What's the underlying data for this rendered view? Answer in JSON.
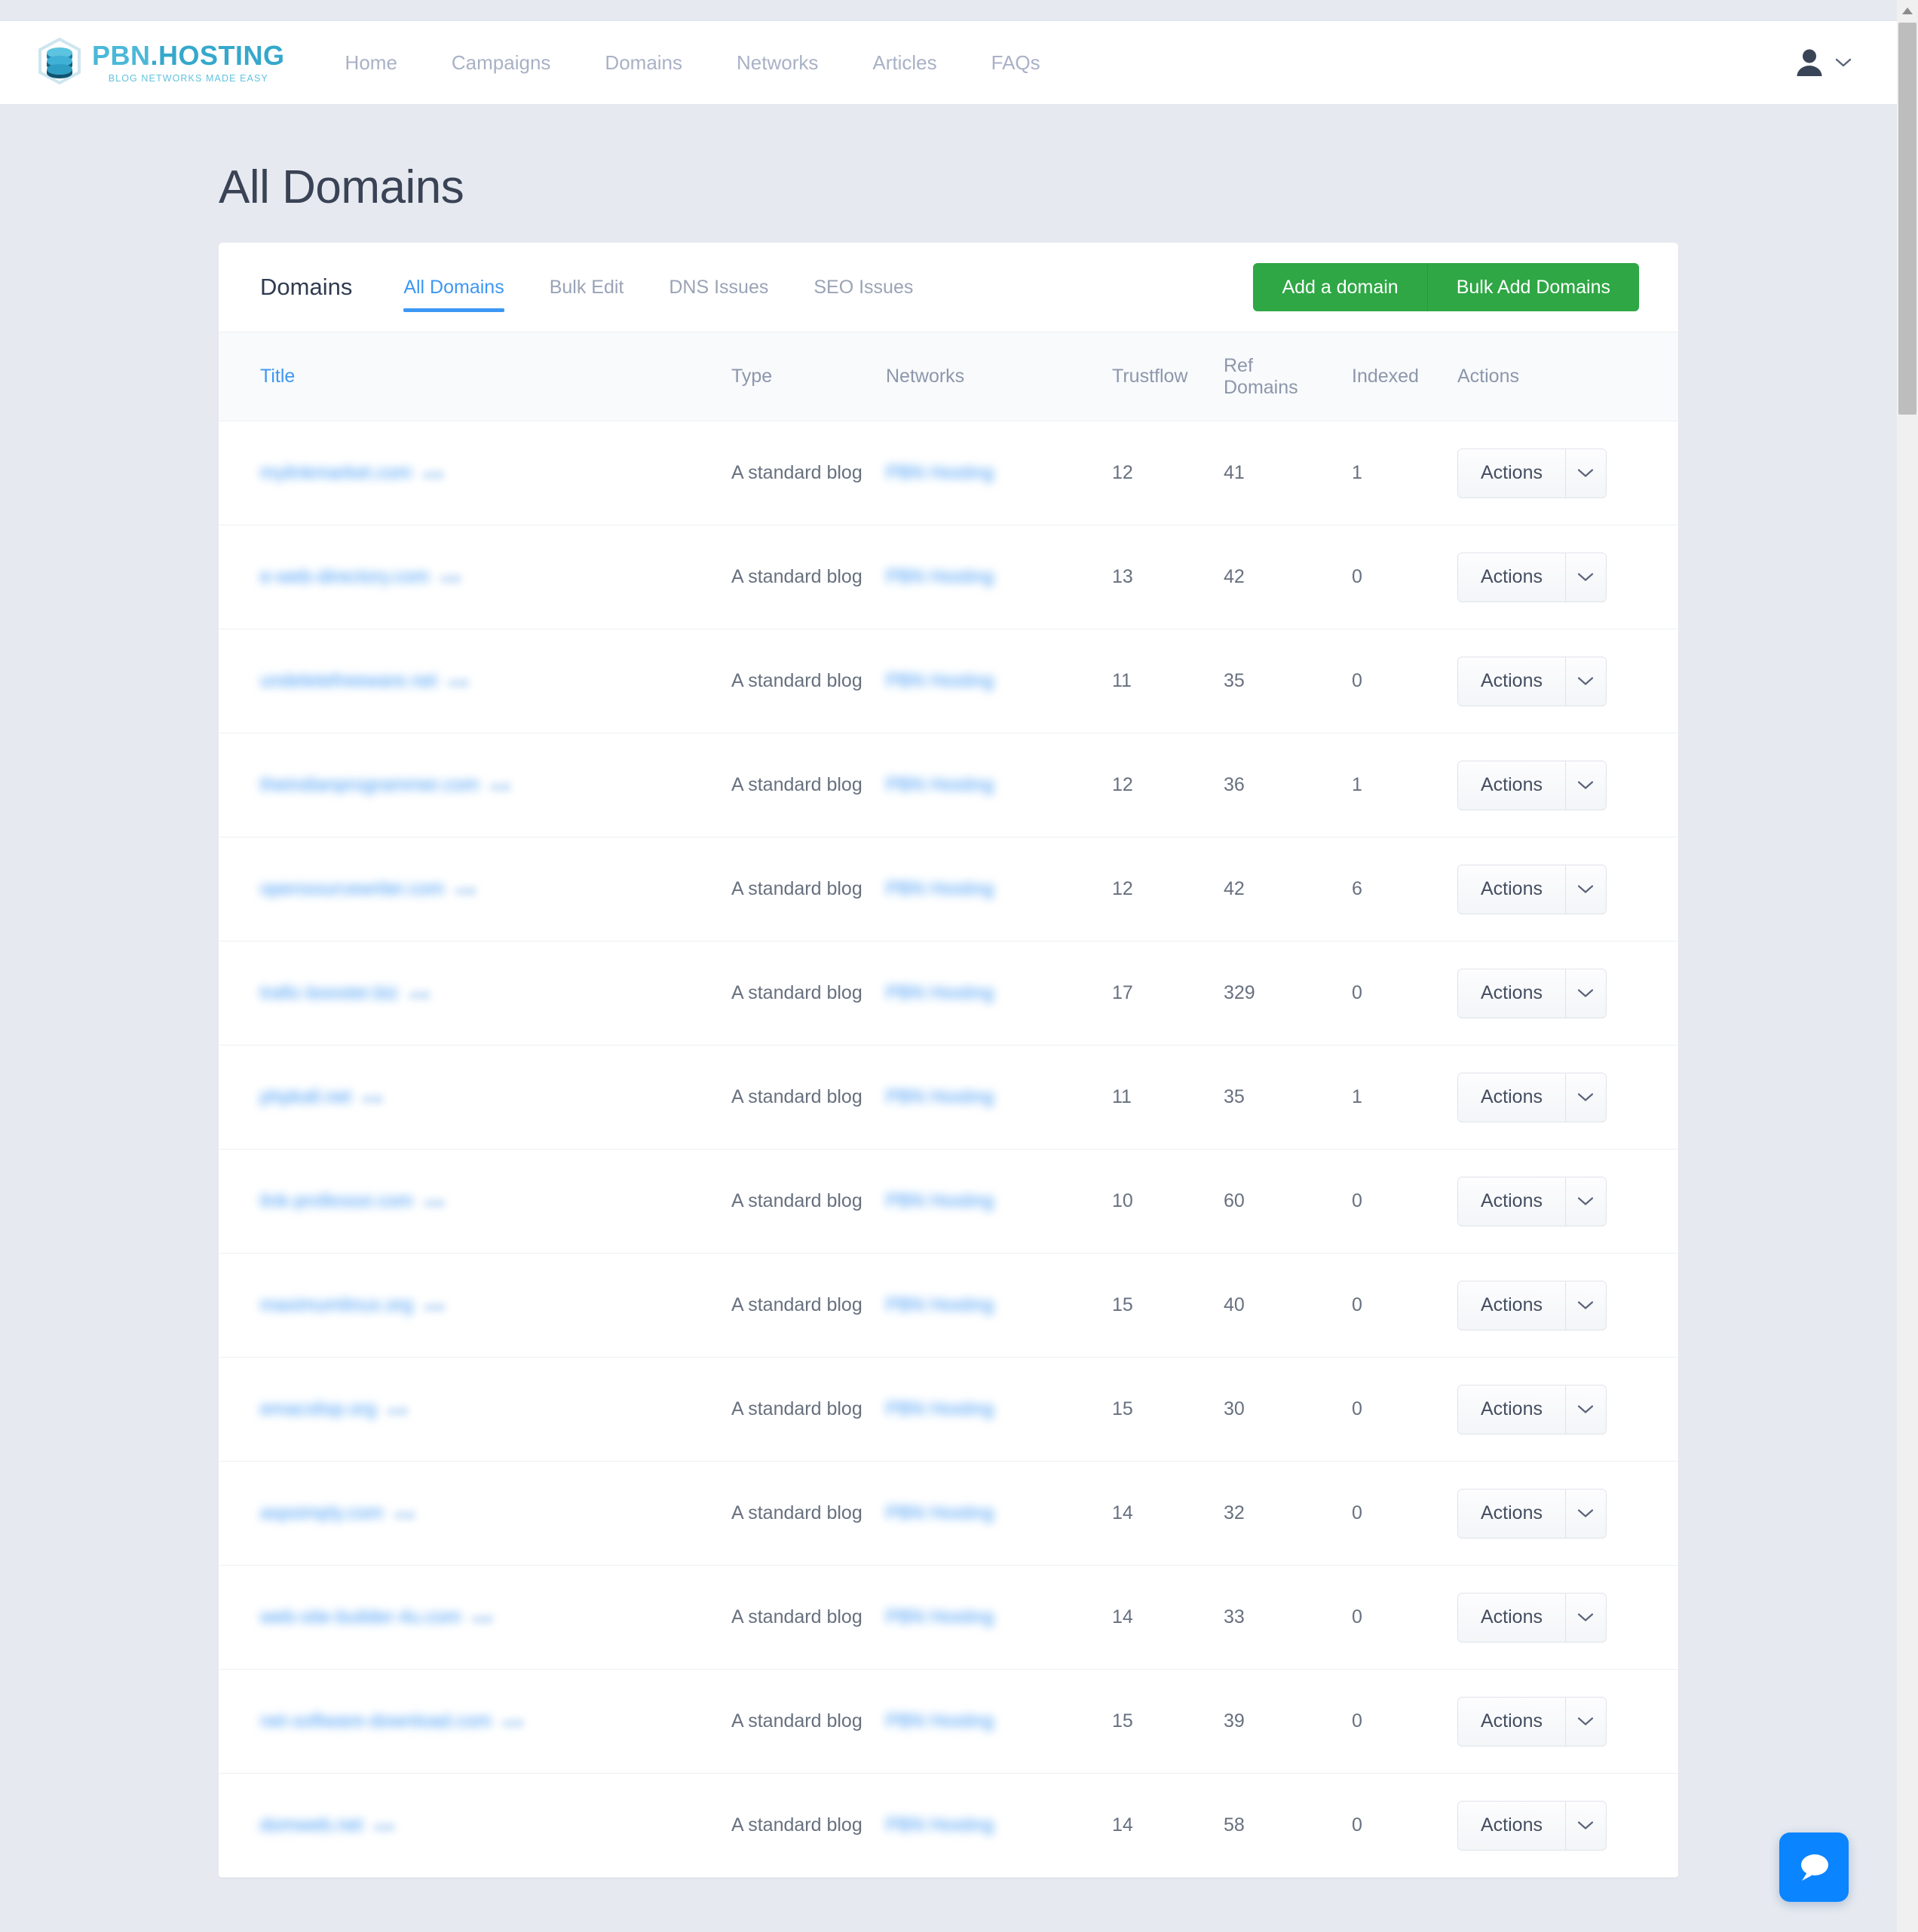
{
  "brand": {
    "title_part1": "PBN",
    "title_dot": ".",
    "title_part2": "HOSTING",
    "tagline": "BLOG NETWORKS MADE EASY"
  },
  "nav": {
    "items": [
      {
        "label": "Home"
      },
      {
        "label": "Campaigns"
      },
      {
        "label": "Domains"
      },
      {
        "label": "Networks"
      },
      {
        "label": "Articles"
      },
      {
        "label": "FAQs"
      }
    ],
    "user_icon": "user-icon",
    "user_caret_icon": "chevron-down-icon"
  },
  "page": {
    "title": "All Domains"
  },
  "card": {
    "heading": "Domains",
    "tabs": [
      {
        "label": "All Domains",
        "active": true
      },
      {
        "label": "Bulk Edit",
        "active": false
      },
      {
        "label": "DNS Issues",
        "active": false
      },
      {
        "label": "SEO Issues",
        "active": false
      }
    ],
    "buttons": {
      "add_domain": "Add a domain",
      "bulk_add": "Bulk Add Domains"
    }
  },
  "table": {
    "columns": [
      {
        "key": "title",
        "label": "Title"
      },
      {
        "key": "type",
        "label": "Type"
      },
      {
        "key": "network",
        "label": "Networks"
      },
      {
        "key": "tf",
        "label": "Trustflow"
      },
      {
        "key": "ref1",
        "label": "Ref"
      },
      {
        "key": "ref2",
        "label": "Domains"
      },
      {
        "key": "idx",
        "label": "Indexed"
      },
      {
        "key": "actions",
        "label": "Actions"
      }
    ],
    "row_action_label": "Actions",
    "row_action_caret_icon": "chevron-down-icon",
    "visit_label": "visit",
    "rows": [
      {
        "title": "mylinkmarket.com",
        "type": "A standard blog",
        "network": "PBN Hosting",
        "trustflow": "12",
        "ref_domains": "41",
        "indexed": "1"
      },
      {
        "title": "e-web-directory.com",
        "type": "A standard blog",
        "network": "PBN Hosting",
        "trustflow": "13",
        "ref_domains": "42",
        "indexed": "0"
      },
      {
        "title": "undeletefreeware.net",
        "type": "A standard blog",
        "network": "PBN Hosting",
        "trustflow": "11",
        "ref_domains": "35",
        "indexed": "0"
      },
      {
        "title": "theindianprogrammer.com",
        "type": "A standard blog",
        "network": "PBN Hosting",
        "trustflow": "12",
        "ref_domains": "36",
        "indexed": "1"
      },
      {
        "title": "opensourcewriter.com",
        "type": "A standard blog",
        "network": "PBN Hosting",
        "trustflow": "12",
        "ref_domains": "42",
        "indexed": "6"
      },
      {
        "title": "trafic-booster.biz",
        "type": "A standard blog",
        "network": "PBN Hosting",
        "trustflow": "17",
        "ref_domains": "329",
        "indexed": "0"
      },
      {
        "title": "phpkall.net",
        "type": "A standard blog",
        "network": "PBN Hosting",
        "trustflow": "11",
        "ref_domains": "35",
        "indexed": "1"
      },
      {
        "title": "link-professor.com",
        "type": "A standard blog",
        "network": "PBN Hosting",
        "trustflow": "10",
        "ref_domains": "60",
        "indexed": "0"
      },
      {
        "title": "maximumlinux.org",
        "type": "A standard blog",
        "network": "PBN Hosting",
        "trustflow": "15",
        "ref_domains": "40",
        "indexed": "0"
      },
      {
        "title": "emacslisp.org",
        "type": "A standard blog",
        "network": "PBN Hosting",
        "trustflow": "15",
        "ref_domains": "30",
        "indexed": "0"
      },
      {
        "title": "aspsimply.com",
        "type": "A standard blog",
        "network": "PBN Hosting",
        "trustflow": "14",
        "ref_domains": "32",
        "indexed": "0"
      },
      {
        "title": "web-site-builder-4u.com",
        "type": "A standard blog",
        "network": "PBN Hosting",
        "trustflow": "14",
        "ref_domains": "33",
        "indexed": "0"
      },
      {
        "title": "net-software-download.com",
        "type": "A standard blog",
        "network": "PBN Hosting",
        "trustflow": "15",
        "ref_domains": "39",
        "indexed": "0"
      },
      {
        "title": "domweb.net",
        "type": "A standard blog",
        "network": "PBN Hosting",
        "trustflow": "14",
        "ref_domains": "58",
        "indexed": "0"
      }
    ]
  },
  "chat": {
    "icon": "chat-bubble-icon"
  },
  "colors": {
    "brand_blue": "#4bb8d8",
    "link_blue": "#3d97f5",
    "green_button": "#2fa745",
    "chat_blue": "#0b84ff",
    "page_bg": "#e6eaf0",
    "text_dark": "#3a4355"
  }
}
